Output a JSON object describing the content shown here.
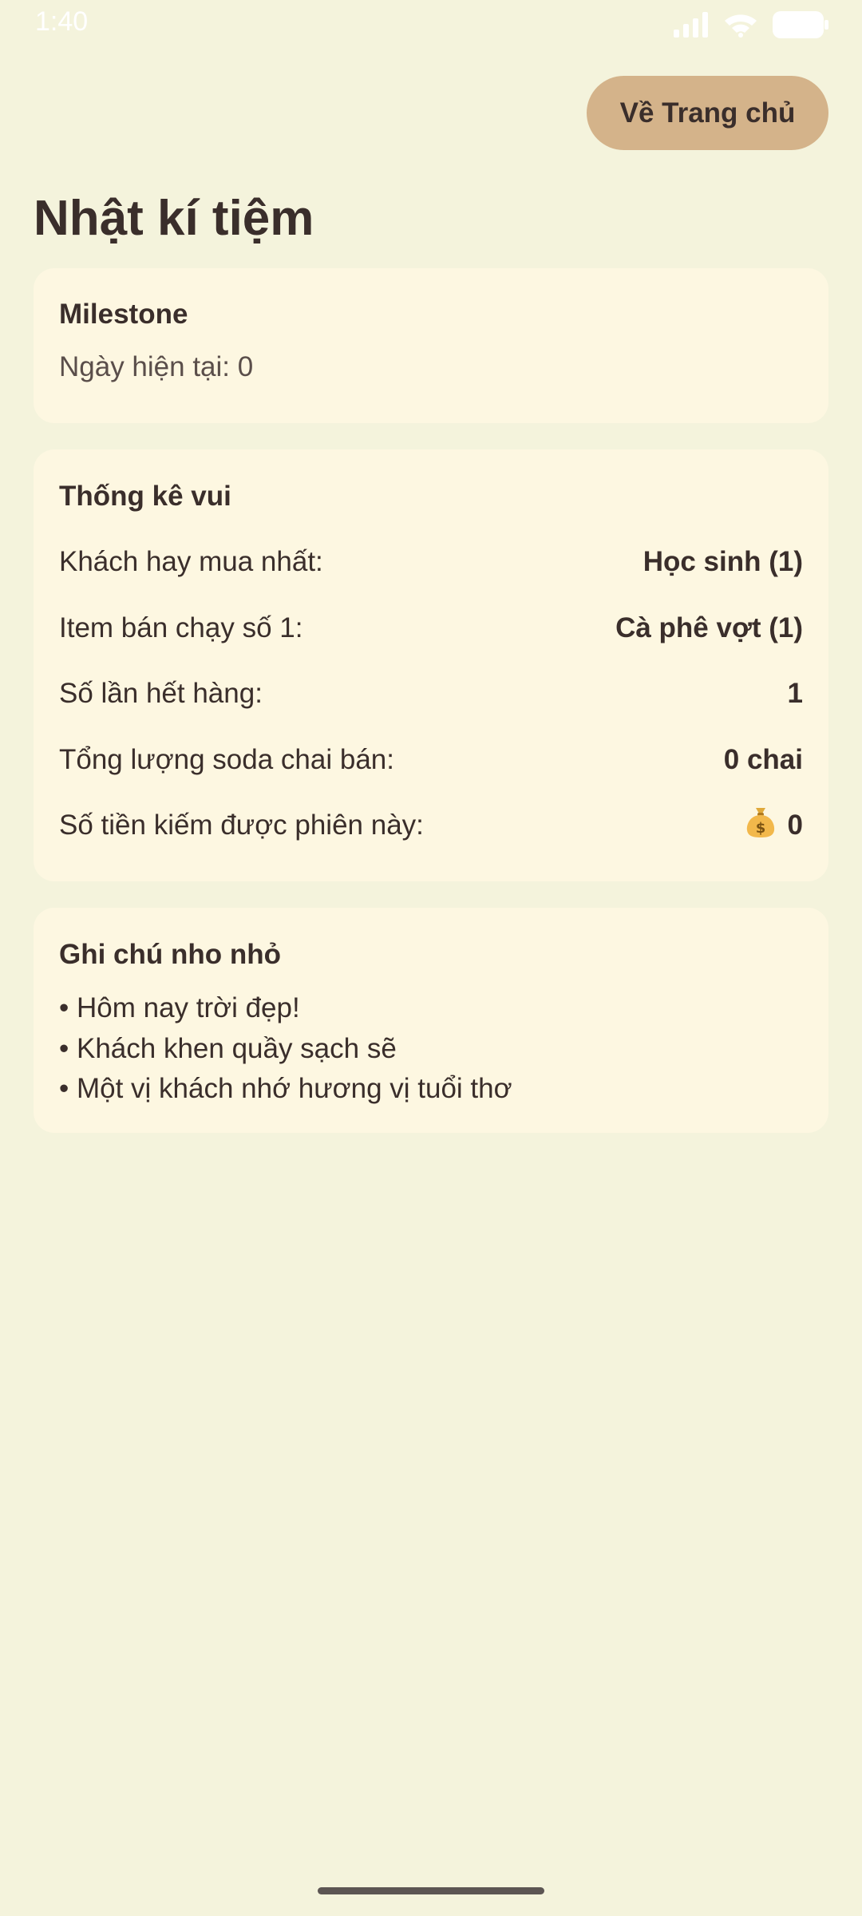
{
  "status_bar": {
    "time": "1:40",
    "icons": [
      "signal-icon",
      "wifi-icon",
      "battery-icon"
    ]
  },
  "header": {
    "home_button_label": "Về Trang chủ",
    "title": "Nhật kí tiệm"
  },
  "milestone": {
    "title": "Milestone",
    "current_day": "Ngày hiện tại: 0"
  },
  "stats": {
    "title": "Thống kê vui",
    "rows": [
      {
        "label": "Khách hay mua nhất:",
        "value": "Học sinh (1)"
      },
      {
        "label": "Item bán chạy số 1:",
        "value": "Cà phê vợt (1)"
      },
      {
        "label": "Số lần hết hàng:",
        "value": "1"
      },
      {
        "label": "Tổng lượng soda chai bán:",
        "value": "0 chai"
      },
      {
        "label": "Số tiền kiếm được phiên này:",
        "value": "0",
        "icon": "money-bag-icon"
      }
    ]
  },
  "notes": {
    "title": "Ghi chú nho nhỏ",
    "items": [
      "• Hôm nay trời đẹp!",
      "• Khách khen quầy sạch sẽ",
      "• Một vị khách nhớ hương vị tuổi thơ"
    ]
  },
  "colors": {
    "background": "#F4F3DC",
    "card": "#FDF7E1",
    "button": "#D4B38A",
    "text": "#3A2E2B"
  }
}
